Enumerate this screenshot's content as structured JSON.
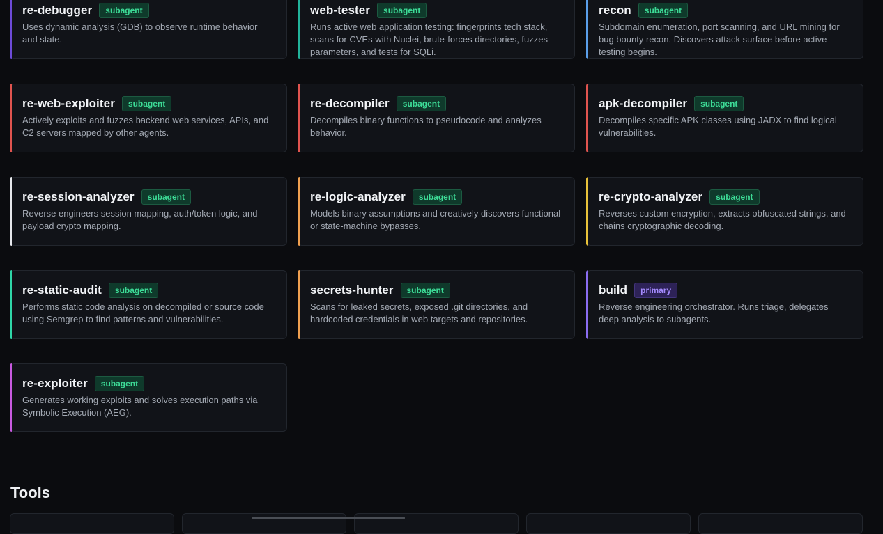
{
  "agents": [
    {
      "name": "re-debugger",
      "badge": "subagent",
      "desc": "Uses dynamic analysis (GDB) to observe runtime behavior and state.",
      "accent": "#6d4bd8"
    },
    {
      "name": "web-tester",
      "badge": "subagent",
      "desc": "Runs active web application testing: fingerprints tech stack, scans for CVEs with Nuclei, brute-forces directories, fuzzes parameters, and tests for SQLi.",
      "accent": "#22b39a"
    },
    {
      "name": "recon",
      "badge": "subagent",
      "desc": "Subdomain enumeration, port scanning, and URL mining for bug bounty recon. Discovers attack surface before active testing begins.",
      "accent": "#5a9ee8"
    },
    {
      "name": "re-web-exploiter",
      "badge": "subagent",
      "desc": "Actively exploits and fuzzes backend web services, APIs, and C2 servers mapped by other agents.",
      "accent": "#e0544f"
    },
    {
      "name": "re-decompiler",
      "badge": "subagent",
      "desc": "Decompiles binary functions to pseudocode and analyzes behavior.",
      "accent": "#e0544f"
    },
    {
      "name": "apk-decompiler",
      "badge": "subagent",
      "desc": "Decompiles specific APK classes using JADX to find logical vulnerabilities.",
      "accent": "#e0544f"
    },
    {
      "name": "re-session-analyzer",
      "badge": "subagent",
      "desc": "Reverse engineers session mapping, auth/token logic, and payload crypto mapping.",
      "accent": "#e6e8ec"
    },
    {
      "name": "re-logic-analyzer",
      "badge": "subagent",
      "desc": "Models binary assumptions and creatively discovers functional or state-machine bypasses.",
      "accent": "#f0a050"
    },
    {
      "name": "re-crypto-analyzer",
      "badge": "subagent",
      "desc": "Reverses custom encryption, extracts obfuscated strings, and chains cryptographic decoding.",
      "accent": "#e8c23a"
    },
    {
      "name": "re-static-audit",
      "badge": "subagent",
      "desc": "Performs static code analysis on decompiled or source code using Semgrep to find patterns and vulnerabilities.",
      "accent": "#2fd6a8"
    },
    {
      "name": "secrets-hunter",
      "badge": "subagent",
      "desc": "Scans for leaked secrets, exposed .git directories, and hardcoded credentials in web targets and repositories.",
      "accent": "#f0a050"
    },
    {
      "name": "build",
      "badge": "primary",
      "desc": "Reverse engineering orchestrator. Runs triage, delegates deep analysis to subagents.",
      "accent": "#8a6cf0"
    },
    {
      "name": "re-exploiter",
      "badge": "subagent",
      "desc": "Generates working exploits and solves execution paths via Symbolic Execution (AEG).",
      "accent": "#c85ae0"
    }
  ],
  "tools": {
    "title": "Tools"
  }
}
